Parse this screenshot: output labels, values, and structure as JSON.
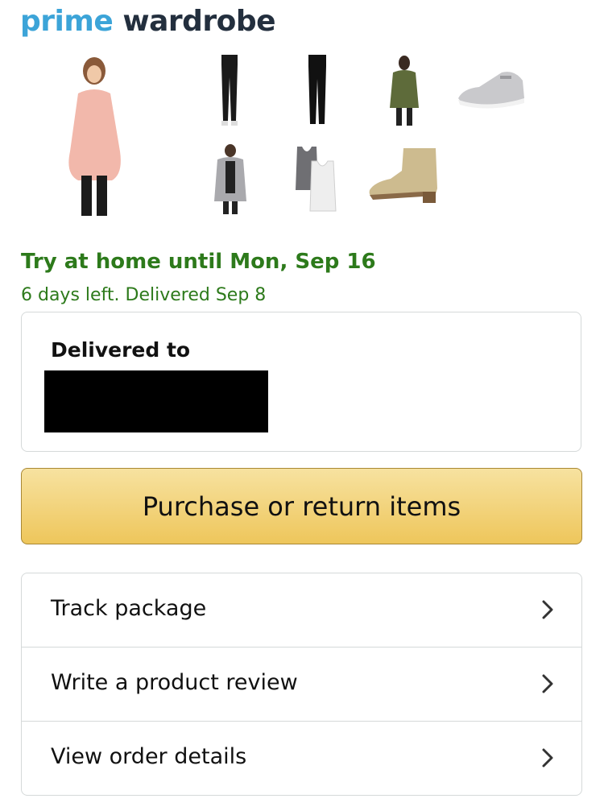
{
  "logo": {
    "part1": "prime",
    "part2": "wardrobe"
  },
  "items": [
    {
      "name": "pink sweater"
    },
    {
      "name": "black leggings"
    },
    {
      "name": "black pants"
    },
    {
      "name": "green jacket"
    },
    {
      "name": "grey sneakers"
    },
    {
      "name": "grey cardigan"
    },
    {
      "name": "tank tops"
    },
    {
      "name": "tan ankle boot"
    }
  ],
  "status": {
    "headline": "Try at home until Mon, Sep 16",
    "sub": "6 days left. Delivered Sep 8"
  },
  "delivery": {
    "label": "Delivered to"
  },
  "primary_button": {
    "label": "Purchase or return items"
  },
  "actions": [
    {
      "label": "Track package"
    },
    {
      "label": "Write a product review"
    },
    {
      "label": "View order details"
    }
  ],
  "colors": {
    "brand_blue": "#3ca4d8",
    "brand_dark": "#232f3e",
    "status_green": "#2d7a1b",
    "button_yellow": "#eec65b"
  }
}
